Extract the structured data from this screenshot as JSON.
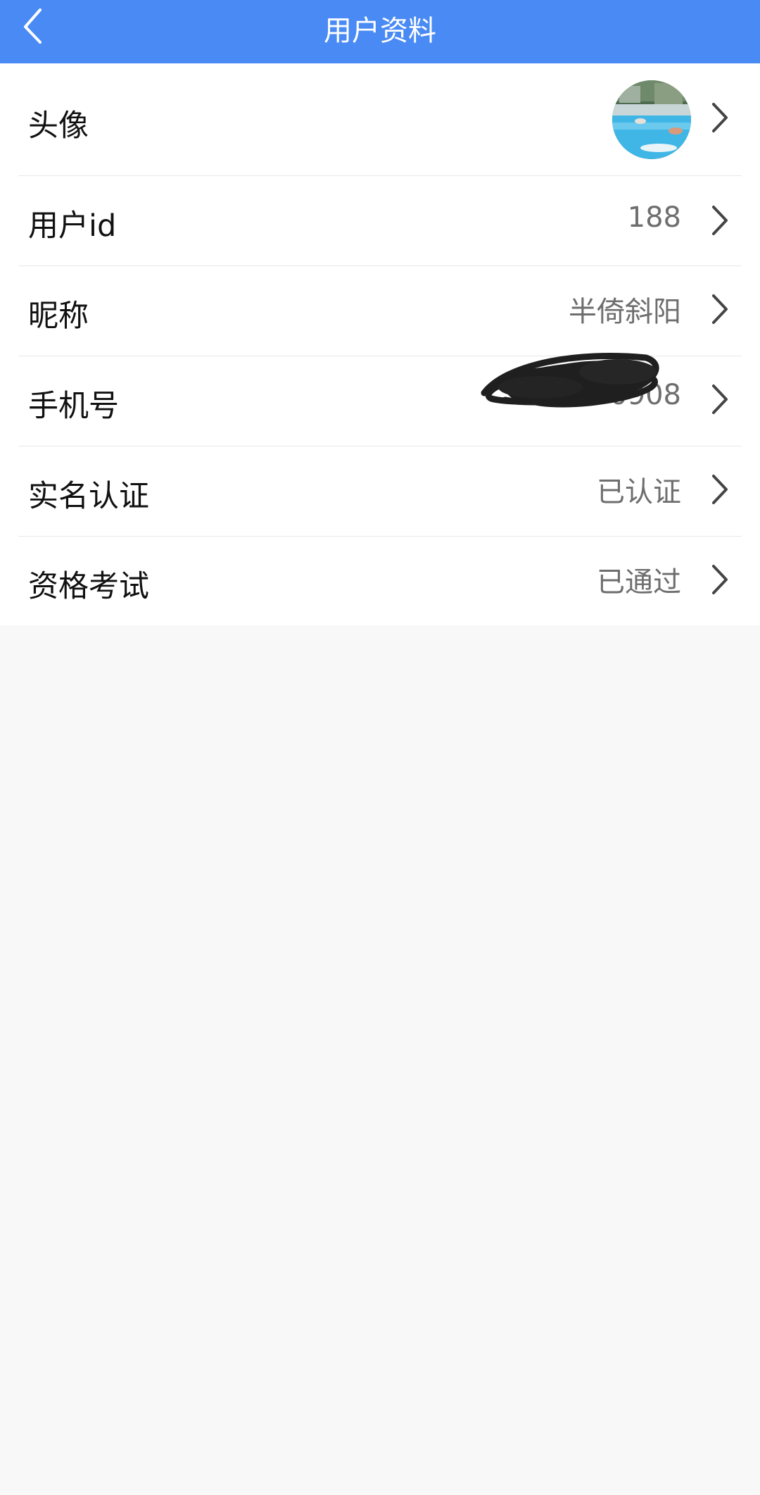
{
  "header": {
    "title": "用户资料",
    "back_icon": "chevron-left-icon"
  },
  "profile": {
    "avatar_label": "头像",
    "user_id_label": "用户id",
    "user_id_value": "188",
    "nickname_label": "昵称",
    "nickname_value": "半倚斜阳",
    "phone_label": "手机号",
    "phone_value": "0908",
    "realname_label": "实名认证",
    "realname_value": "已认证",
    "exam_label": "资格考试",
    "exam_value": "已通过"
  },
  "colors": {
    "header_bg": "#4a8af4",
    "page_bg": "#f8f8f8",
    "value_text": "#6e6e6e"
  }
}
